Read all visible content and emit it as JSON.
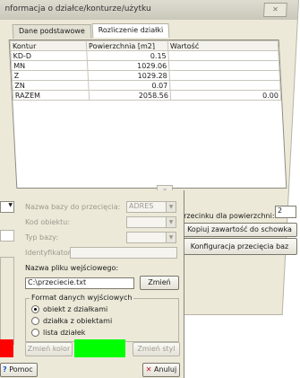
{
  "back_window": {
    "title": "nformacja o działce/konturze/użytku",
    "close_glyph": "✕",
    "tabs": [
      "Dane podstawowe",
      "Rozliczenie działki"
    ],
    "grid": {
      "headers": [
        "Kontur",
        "Powierzchnia [m2]",
        "Wartość"
      ],
      "rows": [
        [
          "KD-D",
          "0.15",
          ""
        ],
        [
          "MN",
          "1029.06",
          ""
        ],
        [
          "Z",
          "1029.28",
          ""
        ],
        [
          "ZN",
          "0.07",
          ""
        ],
        [
          "RAZEM",
          "2058.56",
          "0.00"
        ]
      ]
    },
    "scroll_glyph": "⊻"
  },
  "right_panel": {
    "precision_label": "przecinku dla powierzchni:",
    "precision_value": "2",
    "copy_button": "Kopiuj zawartość do schowka",
    "config_button": "Konfiguracja przecięcia baz"
  },
  "dialog": {
    "base_name_label": "Nazwa bazy do przecięcia:",
    "base_name_value": "ADRES",
    "object_code_label": "Kod obiektu:",
    "base_type_label": "Typ bazy:",
    "identifier_label": "Identyfikator:",
    "input_file_label": "Nazwa pliku wejściowego:",
    "input_file_value": "C:\\przeciecie.txt",
    "change_button": "Zmień",
    "format_group_title": "Format danych wyjściowych",
    "format_options": [
      "obiekt z działkami",
      "działka z obiektami",
      "lista działek"
    ],
    "format_selected": 0,
    "change_color_button": "Zmień kolor",
    "change_style_button": "Zmień styl",
    "help_button": "Pomoc",
    "cancel_button": "Anuluj",
    "colors": {
      "red": "#ff0000",
      "green": "#00ff00"
    }
  }
}
